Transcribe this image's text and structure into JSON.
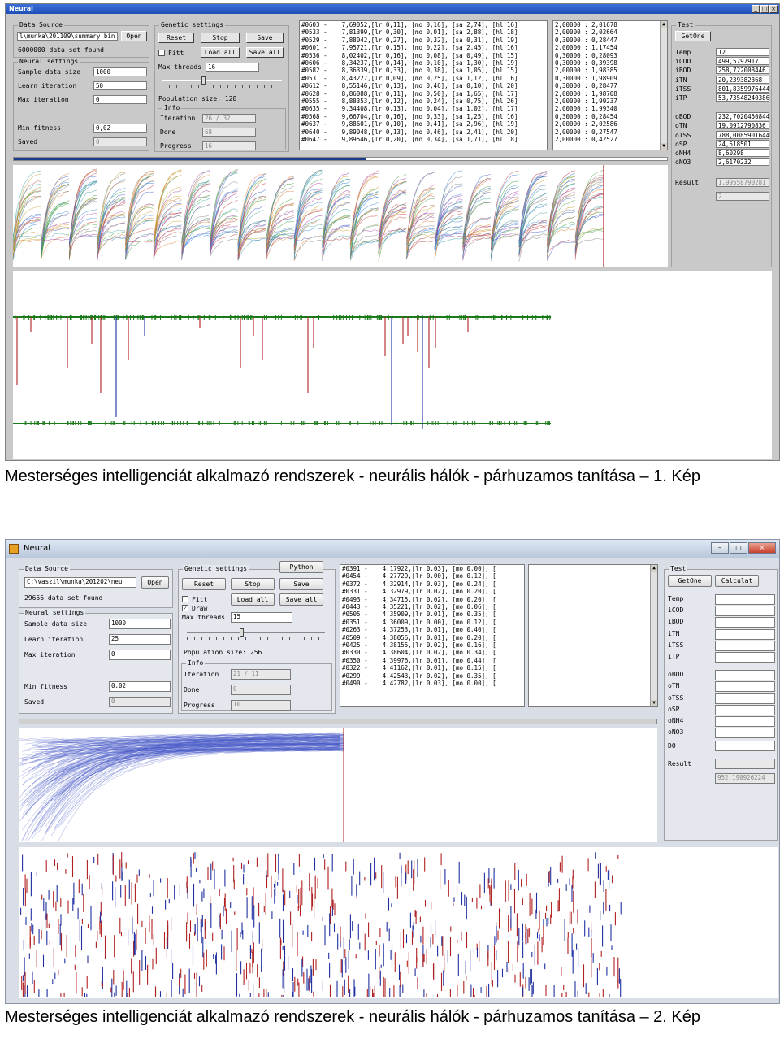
{
  "screenshot1": {
    "window_title": "Neural",
    "data_source": {
      "group_label": "Data Source",
      "path": "l\\munka\\201109\\summary.bin",
      "open_label": "Open",
      "found_text": "6000000 data set found"
    },
    "neural_settings": {
      "group_label": "Neural settings",
      "sample_label": "Sample data size",
      "sample_value": "1000",
      "learn_label": "Learn iteration",
      "learn_value": "50",
      "maxiter_label": "Max iteration",
      "maxiter_value": "0",
      "minfit_label": "Min fitness",
      "minfit_value": "0,02",
      "saved_label": "Saved",
      "saved_value": "0"
    },
    "genetic": {
      "group_label": "Genetic settings",
      "reset": "Reset",
      "stop": "Stop",
      "save": "Save",
      "fitt": "Fitt",
      "load_all": "Load all",
      "save_all": "Save all",
      "threads_label": "Max threads",
      "threads_value": "16",
      "slider_level": 0.35,
      "population": "Population size: 128",
      "info_label": "Info",
      "iteration_label": "Iteration",
      "iteration_value": "26 / 32",
      "done_label": "Done",
      "done_value": "68",
      "progress_label": "Progress",
      "progress_value": "16"
    },
    "log_lines": [
      "#0603 -    7,69052,[lr 0,11], [mo 0,16], [sa 2,74], [hl 16]",
      "#0533 -    7,81399,[lr 0,30], [mo 0,01], [sa 2,88], [hl 18]",
      "#0529 -    7,88042,[lr 0,27], [mo 0,32], [sa 0,31], [hl 19]",
      "#0601 -    7,95721,[lr 0,15], [mo 0,22], [sa 2,45], [hl 16]",
      "#0536 -    8,02402,[lr 0,16], [mo 0,08], [sa 0,49], [hl 15]",
      "#0606 -    8,34237,[lr 0,14], [mo 0,10], [sa 1,30], [hl 19]",
      "#0582 -    8,36339,[lr 0,33], [mo 0,38], [sa 1,05], [hl 15]",
      "#0531 -    8,43227,[lr 0,09], [mo 0,25], [sa 1,12], [hl 16]",
      "#0612 -    8,55146,[lr 0,13], [mo 0,46], [sa 0,10], [hl 20]",
      "#0628 -    8,86088,[lr 0,11], [mo 0,50], [sa 1,65], [hl 17]",
      "#0555 -    8,88353,[lr 0,12], [mo 0,24], [sa 0,75], [hl 26]",
      "#0635 -    9,34408,[lr 0,13], [mo 0,04], [sa 1,02], [hl 17]",
      "#0568 -    9,66704,[lr 0,16], [mo 0,33], [sa 1,25], [hl 16]",
      "#0637 -    9,88601,[lr 0,10], [mo 0,41], [sa 2,96], [hl 19]",
      "#0640 -    9,89048,[lr 0,13], [mo 0,46], [sa 2,41], [hl 20]",
      "#0647 -    9,89546,[lr 0,20], [mo 0,34], [sa 1,71], [hl 18]"
    ],
    "ratio_lines": [
      "2,00000 : 2,01678",
      "2,00000 : 2,02664",
      "0,30000 : 0,28447",
      "2,00000 : 1,17454",
      "0,30000 : 0,28093",
      "0,30000 : 0,39398",
      "2,00000 : 1,98385",
      "0,30000 : 1,98909",
      "0,30000 : 0,28477",
      "2,00000 : 1,98708",
      "2,00000 : 1,99237",
      "2,00000 : 1,99340",
      "0,30000 : 0,28454",
      "2,00000 : 2,02586",
      "2,00000 : 0,27547",
      "2,00000 : 0,42527"
    ],
    "test": {
      "group_label": "Test",
      "getone": "GetOne",
      "params": [
        {
          "label": "Temp",
          "value": "12"
        },
        {
          "label": "iCOD",
          "value": "499,5797917"
        },
        {
          "label": "iBOD",
          "value": "258,722008446"
        },
        {
          "label": "iTN",
          "value": "20,239382368"
        },
        {
          "label": "iTSS",
          "value": "801,8359976444"
        },
        {
          "label": "iTP",
          "value": "53,73548240386"
        },
        {
          "label": "oBOD",
          "value": "232,7020450844"
        },
        {
          "label": "oTN",
          "value": "19,0912790836"
        },
        {
          "label": "oTSS",
          "value": "788,0085901644"
        },
        {
          "label": "oSP",
          "value": "24,518501"
        },
        {
          "label": "oNH4",
          "value": "8,60298"
        },
        {
          "label": "oNO3",
          "value": "2,6170232"
        }
      ],
      "result_label": "Result",
      "result_value": "1,99558790281",
      "result_value2": "2"
    },
    "caption": "Mesterséges intelligenciát alkalmazó rendszerek - neurális hálók - párhuzamos tanítása – 1. Kép"
  },
  "screenshot2": {
    "window_title": "Neural",
    "data_source": {
      "group_label": "Data Source",
      "path": "C:\\vaszil\\munka\\201202\\neu",
      "open_label": "Open",
      "found_text": "29656 data set found"
    },
    "neural_settings": {
      "group_label": "Neural settings",
      "sample_label": "Sample data size",
      "sample_value": "1000",
      "learn_label": "Learn iteration",
      "learn_value": "25",
      "maxiter_label": "Max iteration",
      "maxiter_value": "0",
      "minfit_label": "Min fitness",
      "minfit_value": "0.02",
      "saved_label": "Saved",
      "saved_value": "0"
    },
    "genetic": {
      "group_label": "Genetic settings",
      "python": "Python",
      "reset": "Reset",
      "stop": "Stop",
      "save": "Save",
      "fitt": "Fitt",
      "draw": "Draw",
      "load_all": "Load all",
      "save_all": "Save all",
      "threads_label": "Max threads",
      "threads_value": "15",
      "slider_level": 0.4,
      "population": "Population size: 256",
      "info_label": "Info",
      "iteration_label": "Iteration",
      "iteration_value": "21 / 11",
      "done_label": "Done",
      "done_value": "0",
      "progress_label": "Progress",
      "progress_value": "10"
    },
    "log_lines": [
      "#0391 -    4.17922,[lr 0.03], [mo 0.00], [",
      "#0454 -    4.27729,[lr 0.00], [mo 0.12], [",
      "#0372 -    4.32914,[lr 0.03], [mo 0.24], [",
      "#0331 -    4.32979,[lr 0.02], [mo 0.20], [",
      "#0493 -    4.34715,[lr 0.02], [mo 0.20], [",
      "#0443 -    4.35221,[lr 0.02], [mo 0.06], [",
      "#0505 -    4.35909,[lr 0.01], [mo 0.35], [",
      "#0351 -    4.36009,[lr 0.00], [mo 0.12], [",
      "#0263 -    4.37253,[lr 0.01], [mo 0.40], [",
      "#0509 -    4.38056,[lr 0.01], [mo 0.20], [",
      "#0425 -    4.38155,[lr 0.02], [mo 0.16], [",
      "#0330 -    4.38604,[lr 0.02], [mo 0.34], [",
      "#0350 -    4.39976,[lr 0.01], [mo 0.44], [",
      "#0322 -    4.41162,[lr 0.01], [mo 0.15], [",
      "#0299 -    4.42543,[lr 0.02], [mo 0.35], [",
      "#0490 -    4.42782,[lr 0.03], [mo 0.00], ["
    ],
    "test": {
      "group_label": "Test",
      "getone": "GetOne",
      "calculate": "Calculat",
      "params": [
        {
          "label": "Temp",
          "value": ""
        },
        {
          "label": "iCOD",
          "value": ""
        },
        {
          "label": "iBOD",
          "value": ""
        },
        {
          "label": "iTN",
          "value": ""
        },
        {
          "label": "iTSS",
          "value": ""
        },
        {
          "label": "iTP",
          "value": ""
        },
        {
          "label": "oBOD",
          "value": ""
        },
        {
          "label": "oTN",
          "value": ""
        },
        {
          "label": "oTSS",
          "value": ""
        },
        {
          "label": "oSP",
          "value": ""
        },
        {
          "label": "oNH4",
          "value": ""
        },
        {
          "label": "oNO3",
          "value": ""
        }
      ],
      "do_label": "DO",
      "do_value": "",
      "result_label": "Result",
      "result_value": "952.190926224"
    },
    "caption": "Mesterséges intelligenciát alkalmazó rendszerek - neurális hálók - párhuzamos tanítása – 2. Kép"
  },
  "colors": {
    "spike_red": "#b02020",
    "spike_blue": "#2030a0",
    "baseline_green": "#1a7a1a",
    "curve_blue": "#4a5cc8",
    "progress_fill": "#1d3b8c"
  }
}
